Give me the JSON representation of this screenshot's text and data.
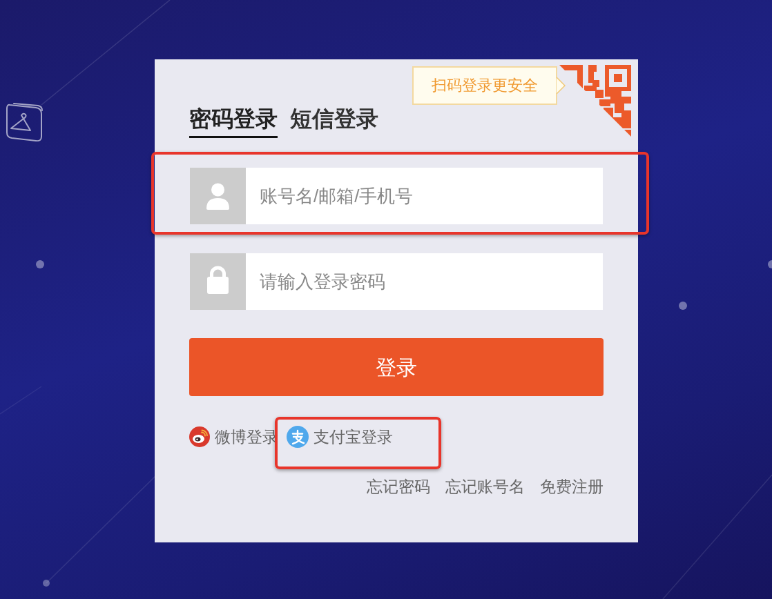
{
  "tabs": [
    {
      "label": "密码登录",
      "selected": true
    },
    {
      "label": "短信登录",
      "selected": false
    }
  ],
  "qr_login": {
    "tooltip": "扫码登录更安全"
  },
  "fields": [
    {
      "kind": "username",
      "placeholder": "账号名/邮箱/手机号",
      "highlighted": true
    },
    {
      "kind": "password",
      "placeholder": "请输入登录密码",
      "highlighted": false
    }
  ],
  "submit_button": {
    "label": "登录"
  },
  "social_logins": [
    {
      "kind": "weibo",
      "label": "微博登录",
      "highlighted": false
    },
    {
      "kind": "alipay",
      "label": "支付宝登录",
      "highlighted": true
    }
  ],
  "links": [
    "忘记密码",
    "忘记账号名",
    "免费注册"
  ]
}
